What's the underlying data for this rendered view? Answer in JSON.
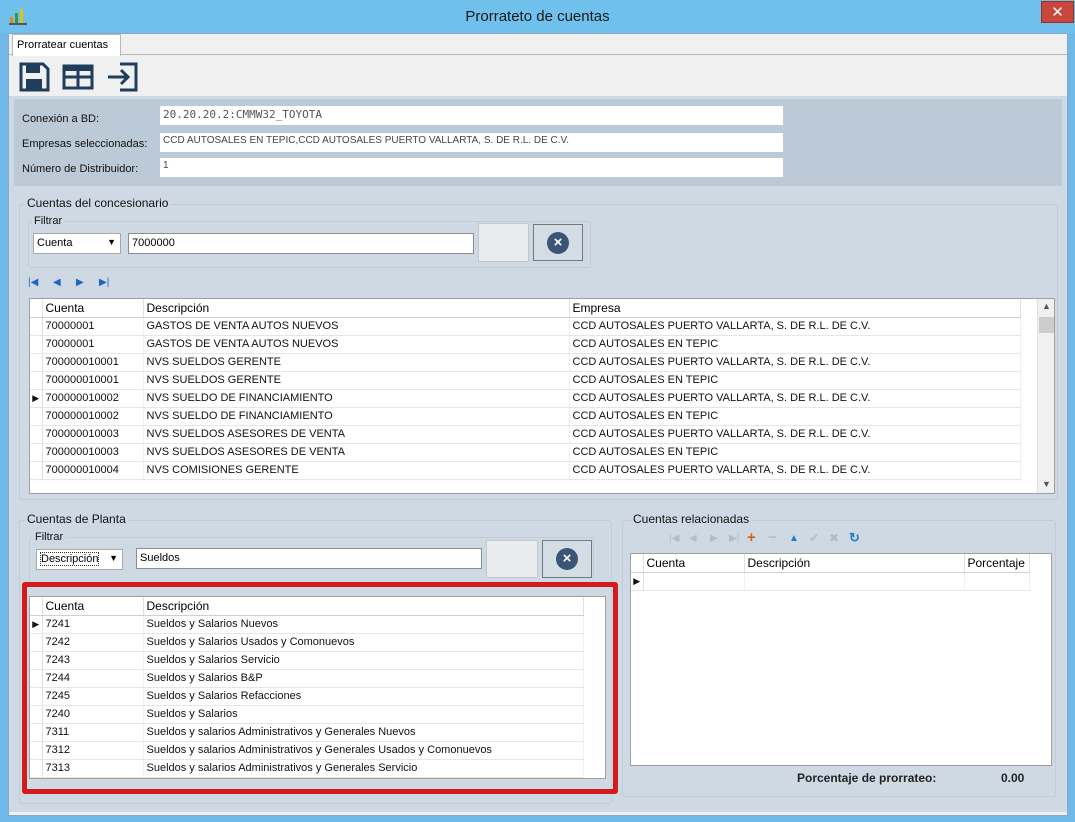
{
  "window": {
    "title": "Prorrateto de cuentas",
    "close_label": "✕"
  },
  "tabs": [
    {
      "label": "Prorratear cuentas"
    }
  ],
  "toolbar": {
    "icons": [
      "save-icon",
      "grid-icon",
      "exit-icon"
    ]
  },
  "connection": {
    "db_label": "Conexión a BD:",
    "db_value": "20.20.20.2:CMMW32_TOYOTA",
    "companies_label": "Empresas seleccionadas:",
    "companies_value": "CCD AUTOSALES EN TEPIC,CCD AUTOSALES PUERTO VALLARTA, S. DE R.L. DE C.V.",
    "distributor_label": "Número de Distribuidor:",
    "distributor_value": "1"
  },
  "dealer_accounts": {
    "title": "Cuentas del concesionario",
    "filter_title": "Filtrar",
    "filter_field": "Cuenta",
    "filter_value": "7000000",
    "columns": [
      "Cuenta",
      "Descripción",
      "Empresa"
    ],
    "rows": [
      [
        "70000001",
        "GASTOS DE VENTA AUTOS NUEVOS",
        "CCD AUTOSALES PUERTO VALLARTA, S. DE R.L. DE C.V."
      ],
      [
        "70000001",
        "GASTOS DE VENTA AUTOS NUEVOS",
        "CCD AUTOSALES EN TEPIC"
      ],
      [
        "700000010001",
        "NVS SUELDOS GERENTE",
        "CCD AUTOSALES PUERTO VALLARTA, S. DE R.L. DE C.V."
      ],
      [
        "700000010001",
        "NVS SUELDOS GERENTE",
        "CCD AUTOSALES EN TEPIC"
      ],
      [
        "700000010002",
        "NVS SUELDO DE FINANCIAMIENTO",
        "CCD AUTOSALES PUERTO VALLARTA, S. DE R.L. DE C.V."
      ],
      [
        "700000010002",
        "NVS SUELDO DE FINANCIAMIENTO",
        "CCD AUTOSALES EN TEPIC"
      ],
      [
        "700000010003",
        "NVS SUELDOS ASESORES DE VENTA",
        "CCD AUTOSALES PUERTO VALLARTA, S. DE R.L. DE C.V."
      ],
      [
        "700000010003",
        "NVS SUELDOS ASESORES DE VENTA",
        "CCD AUTOSALES EN TEPIC"
      ],
      [
        "700000010004",
        "NVS COMISIONES GERENTE",
        "CCD AUTOSALES PUERTO VALLARTA, S. DE R.L. DE C.V."
      ]
    ],
    "current_row": 4
  },
  "plant_accounts": {
    "title": "Cuentas de Planta",
    "filter_title": "Filtrar",
    "filter_field": "Descripción",
    "filter_value": "Sueldos",
    "columns": [
      "Cuenta",
      "Descripción"
    ],
    "rows": [
      [
        "7241",
        "Sueldos y Salarios  Nuevos"
      ],
      [
        "7242",
        "Sueldos y Salarios  Usados y Comonuevos"
      ],
      [
        "7243",
        "Sueldos y Salarios  Servicio"
      ],
      [
        "7244",
        "Sueldos y Salarios  B&P"
      ],
      [
        "7245",
        "Sueldos y Salarios  Refacciones"
      ],
      [
        "7240",
        "Sueldos y Salarios"
      ],
      [
        "7311",
        "Sueldos y salarios Administrativos y Generales  Nuevos"
      ],
      [
        "7312",
        "Sueldos y salarios Administrativos y Generales  Usados y Comonuevos"
      ],
      [
        "7313",
        "Sueldos y salarios Administrativos y Generales  Servicio"
      ]
    ],
    "current_row": 0
  },
  "related_accounts": {
    "title": "Cuentas relacionadas",
    "columns": [
      "Cuenta",
      "Descripción",
      "Porcentaje"
    ],
    "total_label": "Porcentaje de prorrateo:",
    "total_value": "0.00"
  },
  "colors": {
    "highlight_frame": "#d21c1c",
    "nav_blue": "#1a66c4"
  }
}
